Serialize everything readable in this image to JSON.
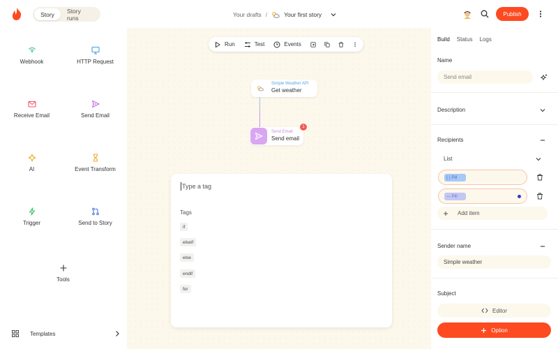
{
  "header": {
    "tabs": [
      {
        "label": "Story",
        "active": true
      },
      {
        "label": "Story runs",
        "active": false
      }
    ],
    "breadcrumb": {
      "parent": "Your drafts",
      "separator": "/",
      "current": "Your first story"
    },
    "publish_label": "Publish",
    "icons": {
      "logo": "flame-logo",
      "avatar": "user-avatar",
      "search": "search-icon",
      "more": "more-vertical-icon"
    }
  },
  "sidebar": {
    "tiles": [
      {
        "label": "Webhook",
        "icon": "webhook-icon",
        "color": "#2fbf8f"
      },
      {
        "label": "HTTP Request",
        "icon": "monitor-icon",
        "color": "#3aa3e3"
      },
      {
        "label": "Receive Email",
        "icon": "mail-icon",
        "color": "#f0526b"
      },
      {
        "label": "Send Email",
        "icon": "send-icon",
        "color": "#c06be0"
      },
      {
        "label": "AI",
        "icon": "sparkle-icon",
        "color": "#f0a818"
      },
      {
        "label": "Event Transform",
        "icon": "hourglass-icon",
        "color": "#f0a818"
      },
      {
        "label": "Trigger",
        "icon": "bolt-icon",
        "color": "#39c36a"
      },
      {
        "label": "Send to Story",
        "icon": "merge-icon",
        "color": "#3b6fd9"
      },
      {
        "label": "Tools",
        "icon": "plus-icon",
        "color": "#333333"
      }
    ],
    "templates_label": "Templates"
  },
  "toolbar": {
    "run_label": "Run",
    "test_label": "Test",
    "events_label": "Events"
  },
  "nodes": {
    "weather": {
      "sub": "Simple Weather API",
      "main": "Get weather"
    },
    "email": {
      "sub": "Send Email",
      "main": "Send email",
      "error_count": "1"
    }
  },
  "tag_picker": {
    "placeholder": "Type a tag",
    "tags_title": "Tags",
    "tags": [
      "if",
      "elseif",
      "else",
      "endif",
      "for"
    ]
  },
  "panel": {
    "tabs": [
      {
        "label": "Build",
        "active": true
      },
      {
        "label": "Status",
        "active": false
      },
      {
        "label": "Logs",
        "active": false
      }
    ],
    "name_label": "Name",
    "name_placeholder": "Send email",
    "description_label": "Description",
    "recipients_label": "Recipients",
    "list_label": "List",
    "recipient_pills": [
      "{ } Pill",
      "— Pill"
    ],
    "add_item_label": "Add item",
    "sender_name_label": "Sender name",
    "sender_name_value": "Simple weather",
    "subject_label": "Subject",
    "editor_label": "Editor",
    "option_label": "Option"
  },
  "colors": {
    "accent": "#fd4a21",
    "canvas": "#fdf8ec"
  }
}
